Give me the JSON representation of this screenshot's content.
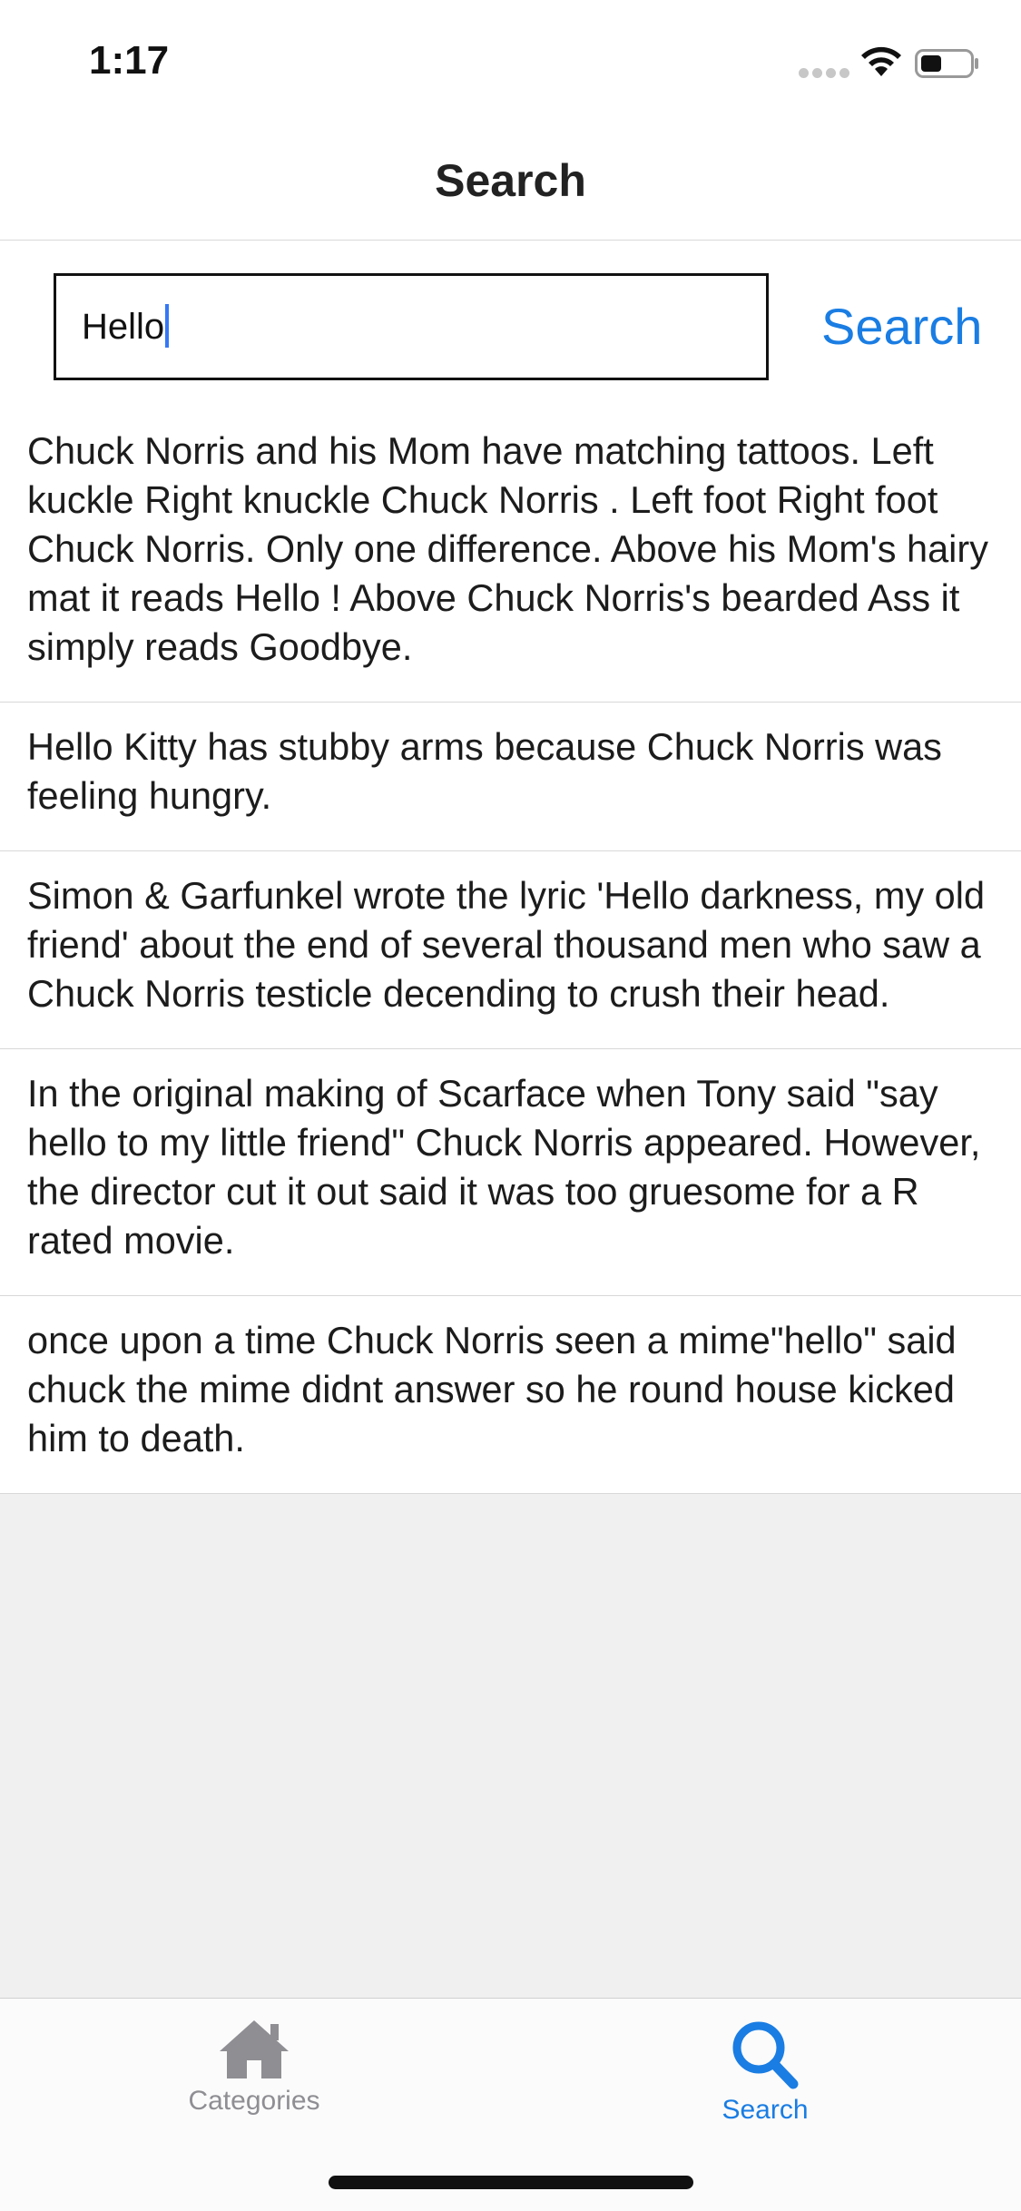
{
  "status_bar": {
    "time": "1:17",
    "icons": [
      "cellular-signal-icon",
      "wifi-icon",
      "battery-icon"
    ]
  },
  "header": {
    "title": "Search"
  },
  "search": {
    "value": "Hello",
    "button_label": "Search"
  },
  "results": [
    "Chuck Norris and his Mom have matching tattoos. Left kuckle Right knuckle Chuck Norris . Left foot Right foot Chuck Norris. Only one difference. Above his Mom's hairy mat it reads Hello ! Above Chuck Norris's bearded Ass it simply reads Goodbye.",
    "Hello Kitty has stubby arms because Chuck Norris was feeling hungry.",
    "Simon & Garfunkel wrote the lyric 'Hello darkness, my old friend' about the end of several thousand men who saw a Chuck Norris testicle decending to crush their head.",
    "In the original making of Scarface when Tony said \"say hello to my little friend\" Chuck Norris appeared. However, the director cut it out said it was too gruesome for a R rated movie.",
    "once upon a time Chuck Norris seen a mime\"hello\" said chuck the mime didnt answer so he round house kicked him to death."
  ],
  "tab_bar": {
    "tabs": [
      {
        "label": "Categories",
        "icon": "home-icon",
        "selected": false
      },
      {
        "label": "Search",
        "icon": "search-icon",
        "selected": true
      }
    ]
  },
  "colors": {
    "accent": "#1a7de3",
    "inactive_tab": "#8e8e93",
    "background": "#f0f0f0",
    "caret": "#3478f6"
  }
}
